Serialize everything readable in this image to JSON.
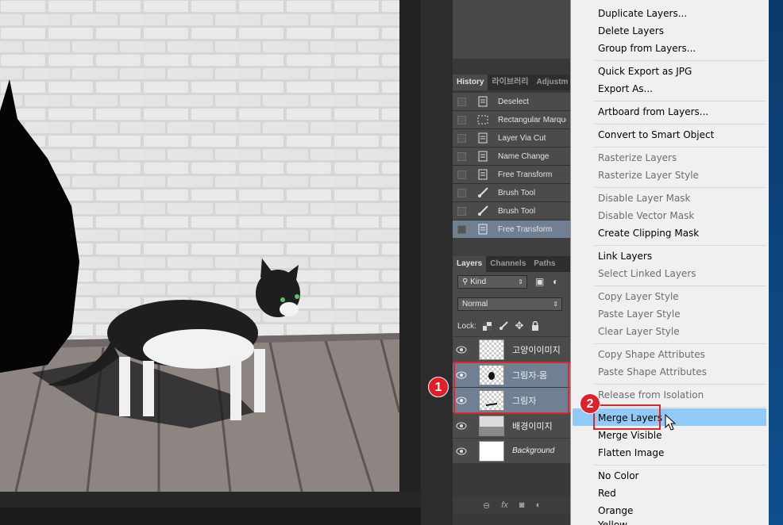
{
  "history": {
    "tabs": [
      "History",
      "라이브러리",
      "Adjustm"
    ],
    "items": [
      {
        "label": "Deselect",
        "icon": "document-icon",
        "active": false
      },
      {
        "label": "Rectangular Marquee",
        "icon": "marquee-icon",
        "active": false
      },
      {
        "label": "Layer Via Cut",
        "icon": "document-icon",
        "active": false
      },
      {
        "label": "Name Change",
        "icon": "document-icon",
        "active": false
      },
      {
        "label": "Free Transform",
        "icon": "document-icon",
        "active": false
      },
      {
        "label": "Brush Tool",
        "icon": "brush-icon",
        "active": false
      },
      {
        "label": "Brush Tool",
        "icon": "brush-icon",
        "active": false
      },
      {
        "label": "Free Transform",
        "icon": "document-icon",
        "active": true
      }
    ]
  },
  "layers": {
    "tabs": [
      "Layers",
      "Channels",
      "Paths"
    ],
    "kind_filter": "Kind",
    "blend_mode": "Normal",
    "lock_label": "Lock:",
    "items": [
      {
        "name": "고양이이미지",
        "thumb": "checker",
        "selected": false
      },
      {
        "name": "그림자-몸",
        "thumb": "checker",
        "selected": true
      },
      {
        "name": "그림자",
        "thumb": "checker",
        "selected": true
      },
      {
        "name": "배경이미지",
        "thumb": "bg",
        "selected": false
      },
      {
        "name": "Background",
        "thumb": "white",
        "selected": false,
        "italic": true
      }
    ],
    "footer_icons": [
      "link-icon",
      "fx-icon",
      "mask-icon",
      "adjustment-icon"
    ]
  },
  "annotations": {
    "step1": "1",
    "step2": "2"
  },
  "context_menu": {
    "items": [
      {
        "label": "Duplicate Layers...",
        "disabled": false
      },
      {
        "label": "Delete Layers",
        "disabled": false
      },
      {
        "label": "Group from Layers...",
        "disabled": false
      },
      {
        "label": "Quick Export as JPG",
        "disabled": false
      },
      {
        "label": "Export As...",
        "disabled": false
      },
      {
        "label": "Artboard from Layers...",
        "disabled": false
      },
      {
        "label": "Convert to Smart Object",
        "disabled": false
      },
      {
        "label": "Rasterize Layers",
        "disabled": true
      },
      {
        "label": "Rasterize Layer Style",
        "disabled": true
      },
      {
        "label": "Disable Layer Mask",
        "disabled": true
      },
      {
        "label": "Disable Vector Mask",
        "disabled": true
      },
      {
        "label": "Create Clipping Mask",
        "disabled": false
      },
      {
        "label": "Link Layers",
        "disabled": false
      },
      {
        "label": "Select Linked Layers",
        "disabled": true
      },
      {
        "label": "Copy Layer Style",
        "disabled": true
      },
      {
        "label": "Paste Layer Style",
        "disabled": true
      },
      {
        "label": "Clear Layer Style",
        "disabled": true
      },
      {
        "label": "Copy Shape Attributes",
        "disabled": true
      },
      {
        "label": "Paste Shape Attributes",
        "disabled": true
      },
      {
        "label": "Release from Isolation",
        "disabled": true
      },
      {
        "label": "Merge Layers",
        "disabled": false,
        "highlighted": true
      },
      {
        "label": "Merge Visible",
        "disabled": false
      },
      {
        "label": "Flatten Image",
        "disabled": false
      },
      {
        "label": "No Color",
        "disabled": false
      },
      {
        "label": "Red",
        "disabled": false
      },
      {
        "label": "Orange",
        "disabled": false
      },
      {
        "label": "Yellow",
        "disabled": false
      }
    ]
  },
  "colors": {
    "annotation_red": "#e11f2a",
    "selected_row": "#6f8093",
    "menu_highlight": "#91c9f7"
  }
}
